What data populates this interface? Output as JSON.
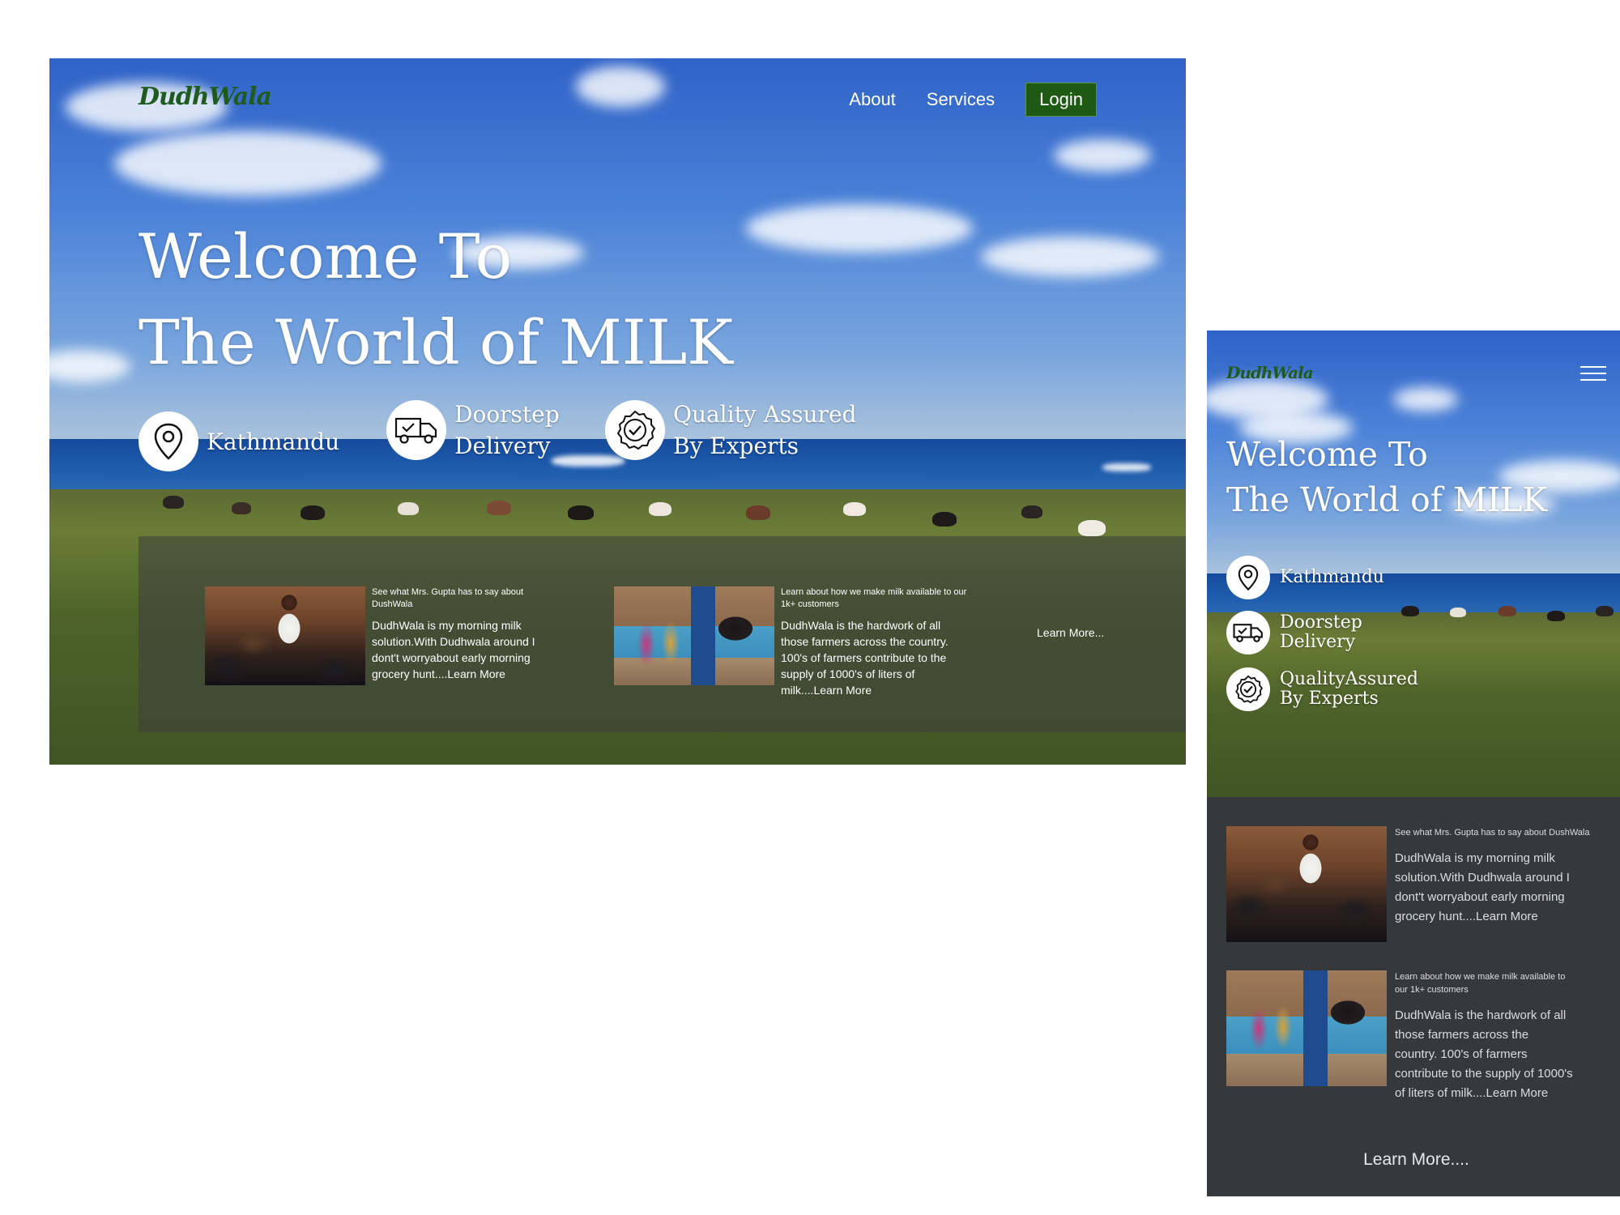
{
  "brand": {
    "logo": "DudhWala",
    "logo_color": "#1f5a1f"
  },
  "desktop": {
    "nav": {
      "about": "About",
      "services": "Services",
      "login": "Login",
      "login_color": "#1e5a13"
    },
    "hero": {
      "line1": "Welcome To",
      "line2": "The World of MILK"
    },
    "features": [
      {
        "icon": "location-pin-icon",
        "line1": "Kathmandu",
        "line2": ""
      },
      {
        "icon": "delivery-truck-icon",
        "line1": "Doorstep",
        "line2": "Delivery"
      },
      {
        "icon": "quality-badge-icon",
        "line1": "Quality Assured",
        "line2": "By Experts"
      }
    ],
    "cards": [
      {
        "caption": "See what Mrs. Gupta has to say about DushWala",
        "body": "DudhWala is my morning milk solution.With Dudhwala around I dont't worryabout early morning grocery hunt....Learn More"
      },
      {
        "caption": "Learn about how we make milk available to our 1k+ customers",
        "body": "DudhWala is the hardwork of all those farmers across the country. 100's of farmers contribute to the supply of 1000's of liters of milk....Learn More"
      }
    ],
    "learn_more": "Learn More..."
  },
  "mobile": {
    "hero": {
      "line1": "Welcome To",
      "line2": "The World of MILK"
    },
    "features": [
      {
        "icon": "location-pin-icon",
        "line1": "Kathmandu",
        "line2": ""
      },
      {
        "icon": "delivery-truck-icon",
        "line1": "Doorstep",
        "line2": "Delivery"
      },
      {
        "icon": "quality-badge-icon",
        "line1": "QualityAssured",
        "line2": "By Experts"
      }
    ],
    "cards": [
      {
        "caption": "See what Mrs. Gupta has to say about DushWala",
        "body": "DudhWala is my morning milk solution.With Dudhwala around I dont't worryabout early morning grocery hunt....Learn More"
      },
      {
        "caption": "Learn about how we make milk available to our 1k+ customers",
        "body": "DudhWala is the hardwork of all those farmers across the country. 100's of farmers contribute to the supply of 1000's of liters of milk....Learn More"
      }
    ],
    "learn_more": "Learn More...."
  },
  "colors": {
    "dark_panel": "#36393b"
  }
}
